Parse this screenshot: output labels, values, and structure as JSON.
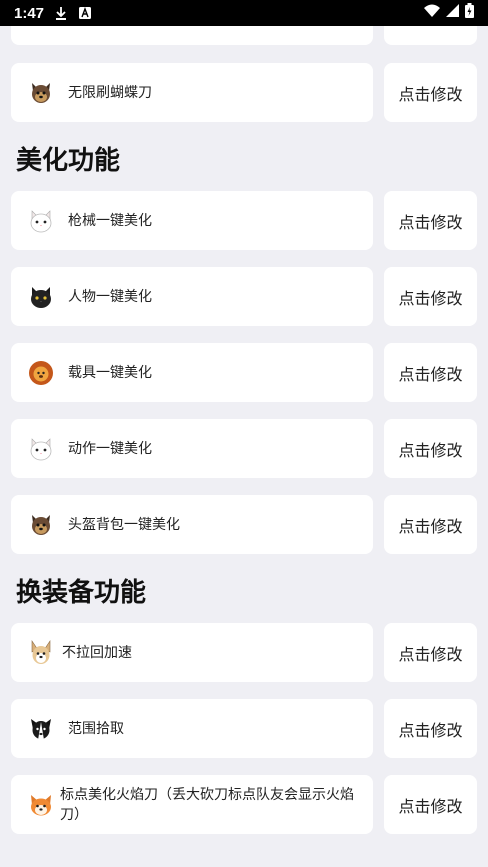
{
  "status_bar": {
    "time": "1:47"
  },
  "modify_label": "点击修改",
  "top_item": {
    "label": "无限刷蝴蝶刀",
    "icon": "yorkie-dog-icon"
  },
  "sections": [
    {
      "title": "美化功能",
      "items": [
        {
          "label": "枪械一键美化",
          "icon": "white-cat-icon"
        },
        {
          "label": "人物一键美化",
          "icon": "black-cat-icon"
        },
        {
          "label": "载具一键美化",
          "icon": "lion-icon"
        },
        {
          "label": "动作一键美化",
          "icon": "white-cat-icon"
        },
        {
          "label": "头盔背包一键美化",
          "icon": "yorkie-dog-icon"
        }
      ]
    },
    {
      "title": "换装备功能",
      "items": [
        {
          "label": "不拉回加速",
          "icon": "corgi-dog-icon"
        },
        {
          "label": "范围拾取",
          "icon": "border-collie-icon"
        },
        {
          "label": "标点美化火焰刀（丢大砍刀标点队友会显示火焰刀）",
          "icon": "shiba-dog-icon"
        }
      ]
    }
  ]
}
